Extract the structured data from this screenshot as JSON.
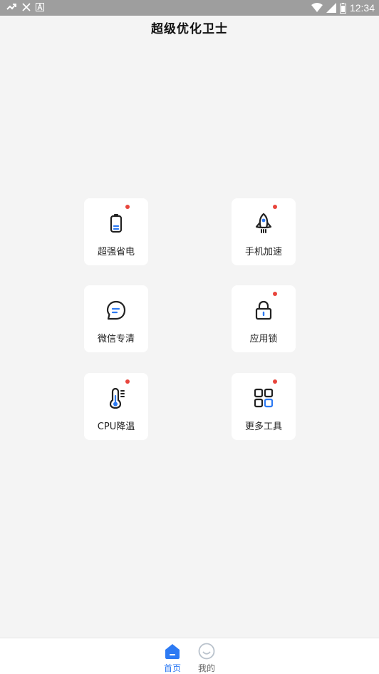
{
  "status_bar": {
    "time": "12:34",
    "icons": [
      "missed-call-icon",
      "close-icon",
      "a-icon",
      "wifi-icon",
      "signal-icon",
      "battery-icon"
    ]
  },
  "app": {
    "title": "超级优化卫士"
  },
  "features": [
    {
      "label": "超强省电",
      "icon": "battery-icon",
      "badge": true
    },
    {
      "label": "手机加速",
      "icon": "rocket-icon",
      "badge": true
    },
    {
      "label": "微信专清",
      "icon": "chat-icon",
      "badge": false
    },
    {
      "label": "应用锁",
      "icon": "lock-icon",
      "badge": true
    },
    {
      "label": "CPU降温",
      "icon": "thermometer-icon",
      "badge": true
    },
    {
      "label": "更多工具",
      "icon": "grid-icon",
      "badge": true
    }
  ],
  "tabs": [
    {
      "label": "首页",
      "icon": "home-icon",
      "active": true
    },
    {
      "label": "我的",
      "icon": "smile-icon",
      "active": false
    }
  ],
  "colors": {
    "accent": "#2d7af3",
    "badge": "#e8453c",
    "tab_inactive": "#666666"
  }
}
